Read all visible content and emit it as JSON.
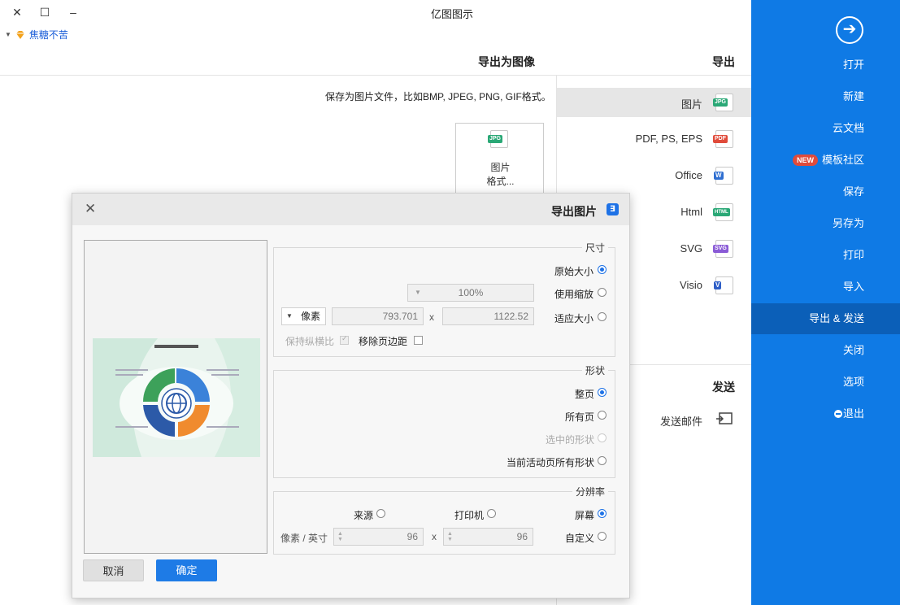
{
  "window": {
    "title": "亿图图示",
    "close": "✕",
    "maximize": "☐",
    "minimize": "–"
  },
  "user": {
    "name": "焦糖不苦"
  },
  "sidebar": {
    "items": [
      {
        "label": "打开"
      },
      {
        "label": "新建"
      },
      {
        "label": "云文档"
      },
      {
        "label": "模板社区",
        "badge": "NEW"
      },
      {
        "label": "保存"
      },
      {
        "label": "另存为"
      },
      {
        "label": "打印"
      },
      {
        "label": "导入"
      },
      {
        "label": "导出 & 发送"
      },
      {
        "label": "关闭"
      },
      {
        "label": "选项"
      },
      {
        "label": "退出"
      }
    ]
  },
  "export": {
    "section_title": "导出",
    "items": [
      {
        "label": "图片",
        "badge": "JPG",
        "color": "#2aa876"
      },
      {
        "label": "PDF, PS, EPS",
        "badge": "PDF",
        "color": "#e04b3b"
      },
      {
        "label": "Office",
        "badge": "W",
        "color": "#2f6fd1"
      },
      {
        "label": "Html",
        "badge": "HTML",
        "color": "#2aa876"
      },
      {
        "label": "SVG",
        "badge": "SVG",
        "color": "#8a5bd6"
      },
      {
        "label": "Visio",
        "badge": "V",
        "color": "#2f5fc7"
      }
    ],
    "send_title": "发送",
    "send_item": "发送邮件"
  },
  "content": {
    "title": "导出为图像",
    "description": "保存为图片文件，比如BMP, JPEG, PNG, GIF格式。",
    "card_line1": "图片",
    "card_line2": "格式...",
    "card_badge": "JPG"
  },
  "dialog": {
    "title": "导出图片",
    "close": "✕",
    "size_group": {
      "label": "尺寸",
      "opt_original": "原始大小",
      "opt_zoom": "使用缩放",
      "zoom_value": "100%",
      "opt_fit": "适应大小",
      "width": "1122.52",
      "height": "793.701",
      "times": "x",
      "unit": "像素",
      "remove_margin": "移除页边距",
      "keep_ratio": "保持纵横比"
    },
    "shape_group": {
      "label": "形状",
      "opt_whole": "整页",
      "opt_all": "所有页",
      "opt_selected": "选中的形状",
      "opt_current": "当前活动页所有形状"
    },
    "resolution_group": {
      "label": "分辨率",
      "opt_screen": "屏幕",
      "opt_printer": "打印机",
      "opt_source": "来源",
      "opt_custom": "自定义",
      "dpi_x": "96",
      "dpi_y": "96",
      "times": "x",
      "unit": "像素 / 英寸"
    },
    "ok": "确定",
    "cancel": "取消"
  }
}
